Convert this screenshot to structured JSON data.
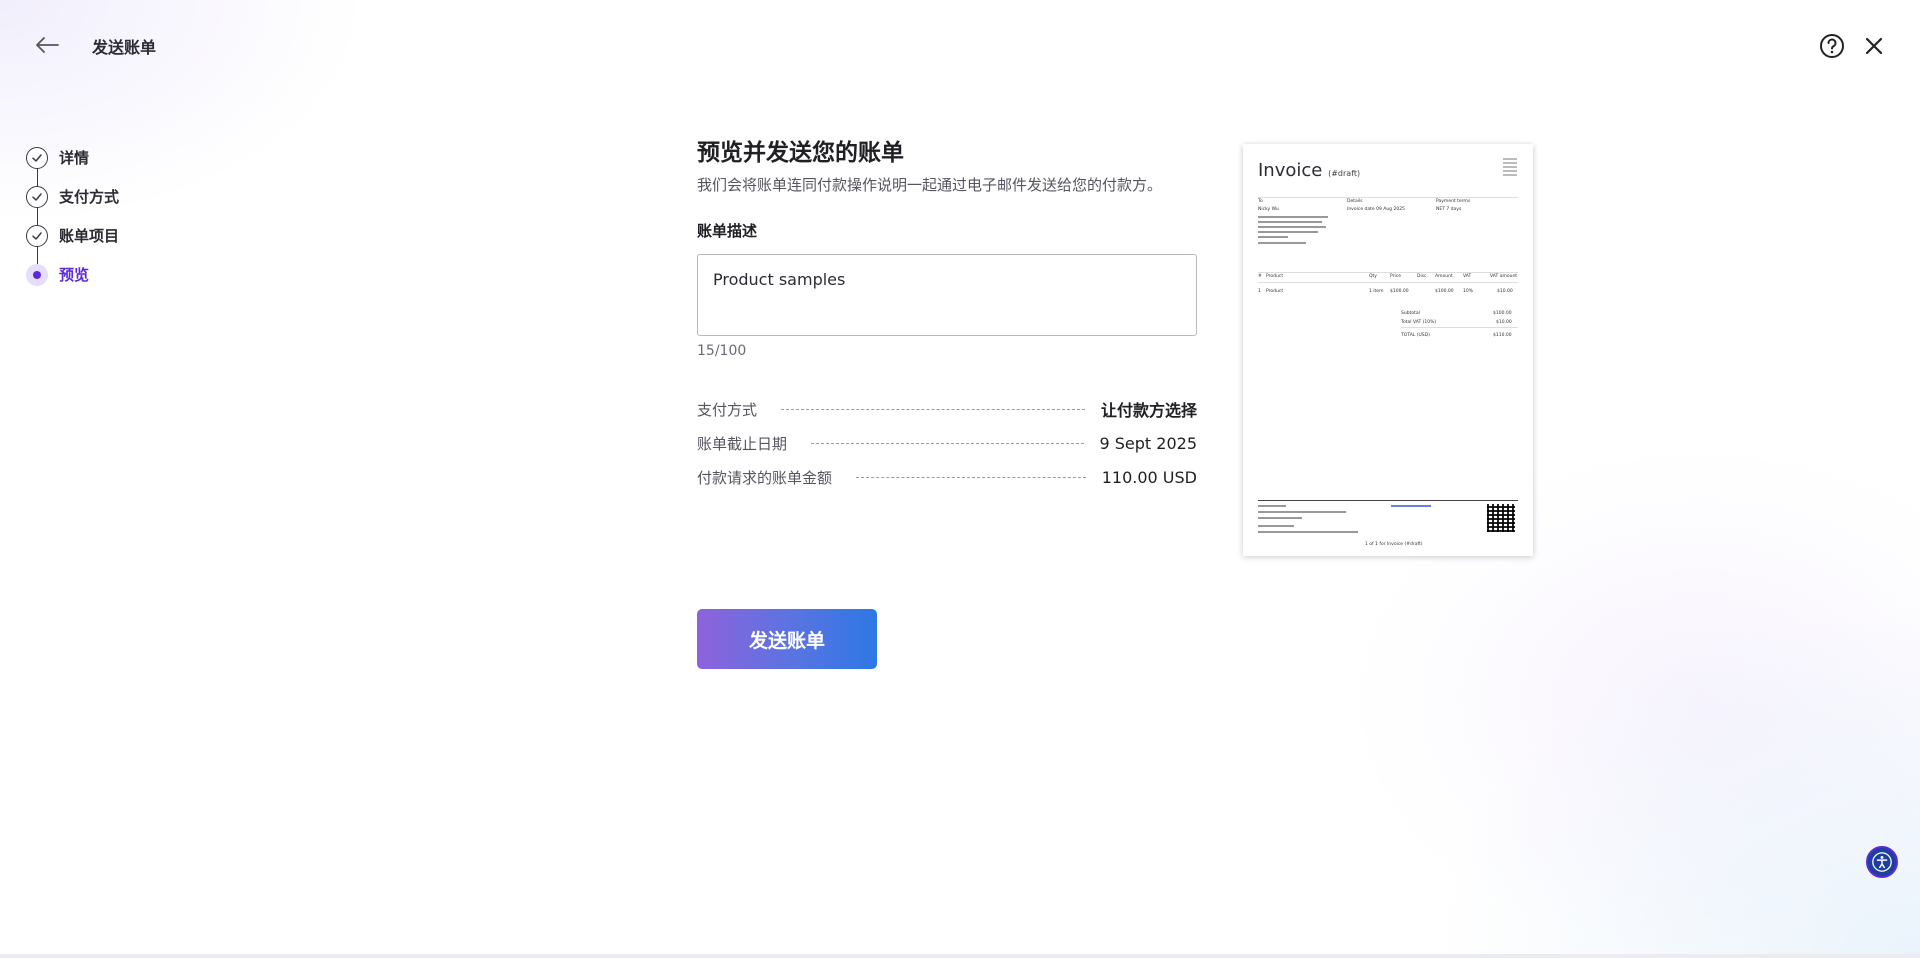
{
  "header": {
    "title": "发送账单"
  },
  "stepper": {
    "steps": [
      {
        "label": "详情",
        "state": "done"
      },
      {
        "label": "支付方式",
        "state": "done"
      },
      {
        "label": "账单项目",
        "state": "done"
      },
      {
        "label": "预览",
        "state": "active"
      }
    ]
  },
  "main": {
    "heading": "预览并发送您的账单",
    "subtitle": "我们会将账单连同付款操作说明一起通过电子邮件发送给您的付款方。",
    "description_label": "账单描述",
    "description_value": "Product samples",
    "char_counter": "15/100",
    "summary": [
      {
        "label": "支付方式",
        "value": "让付款方选择"
      },
      {
        "label": "账单截止日期",
        "value": "9 Sept 2025"
      },
      {
        "label": "付款请求的账单金额",
        "value": "110.00 USD"
      }
    ],
    "send_button": "发送账单"
  },
  "invoice_preview": {
    "title": "Invoice",
    "title_note": "(#draft)",
    "col_to": "To",
    "col_details": "Details",
    "col_payment": "Payment terms",
    "to_name": "Nicky Wu",
    "details_value": "Invoice date 09 Aug 2025",
    "payment_value": "NET 7 days",
    "items_header": [
      "#",
      "Product",
      "Qty",
      "Price",
      "Disc.",
      "Amount",
      "VAT",
      "VAT amount"
    ],
    "items_row": [
      "1",
      "Product",
      "1 item",
      "$100.00",
      "",
      "$100.00",
      "10%",
      "$10.00"
    ],
    "subtotal_label": "Subtotal",
    "subtotal_value": "$100.00",
    "vat_label": "Total VAT (10%)",
    "vat_value": "$10.00",
    "total_label": "TOTAL (USD)",
    "total_value": "$110.00",
    "footer_page": "1 of 1 for Invoice (#draft)"
  },
  "colors": {
    "accent": "#5a2bd8",
    "button_gradient_start": "#8e62dc",
    "button_gradient_end": "#2d78e4"
  },
  "icons": {
    "back": "arrow-left-icon",
    "help": "question-circle-icon",
    "close": "close-icon",
    "step_done": "check-icon",
    "accessibility": "accessibility-icon"
  }
}
